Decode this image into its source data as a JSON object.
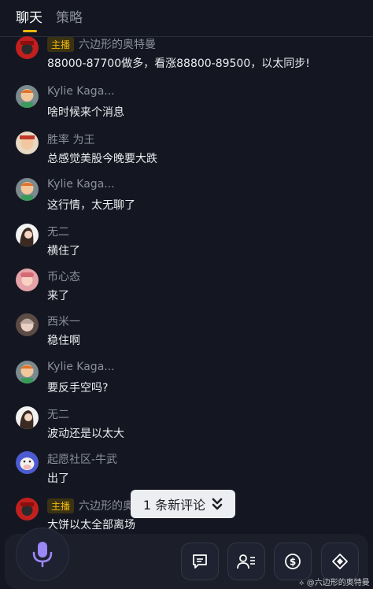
{
  "tabs": [
    {
      "label": "聊天",
      "active": true
    },
    {
      "label": "策略",
      "active": false
    }
  ],
  "colors": {
    "background": "#141722",
    "accent": "#f0b90b",
    "name_gray": "#8b8f9a",
    "mic_purple": "#9b87f5"
  },
  "messages": [
    {
      "badge": "主播",
      "name": "六边形的奥特曼",
      "text": "88000-87700做多，看涨88800-89500，以太同步!",
      "avatar": "red-hat-avatar"
    },
    {
      "badge": "",
      "name": "Kylie Kaga...",
      "text": "啥时候来个消息",
      "avatar": "cartoon-boy-avatar"
    },
    {
      "badge": "",
      "name": "胜率 为王",
      "text": "总感觉美股今晚要大跌",
      "avatar": "cartoon-avatar"
    },
    {
      "badge": "",
      "name": "Kylie Kaga...",
      "text": "这行情，太无聊了",
      "avatar": "cartoon-boy-avatar"
    },
    {
      "badge": "",
      "name": "无二",
      "text": "横住了",
      "avatar": "girl-avatar"
    },
    {
      "badge": "",
      "name": "币心态",
      "text": "来了",
      "avatar": "pink-avatar"
    },
    {
      "badge": "",
      "name": "西米一",
      "text": "稳住啊",
      "avatar": "doll-avatar"
    },
    {
      "badge": "",
      "name": "Kylie Kaga...",
      "text": "要反手空吗?",
      "avatar": "cartoon-boy-avatar"
    },
    {
      "badge": "",
      "name": "无二",
      "text": "波动还是以太大",
      "avatar": "girl-avatar"
    },
    {
      "badge": "",
      "name": "起愿社区-牛武",
      "text": "出了",
      "avatar": "cow-avatar"
    },
    {
      "badge": "主播",
      "name": "六边形的奥特曼",
      "text": "大饼以太全部离场",
      "avatar": "red-hat-avatar"
    }
  ],
  "new_comments": "1 条新评论",
  "bottom_actions": [
    "mic-icon",
    "chat-icon",
    "user-list-icon",
    "dollar-icon",
    "diamond-icon"
  ],
  "watermark": "六边形的奥特曼"
}
